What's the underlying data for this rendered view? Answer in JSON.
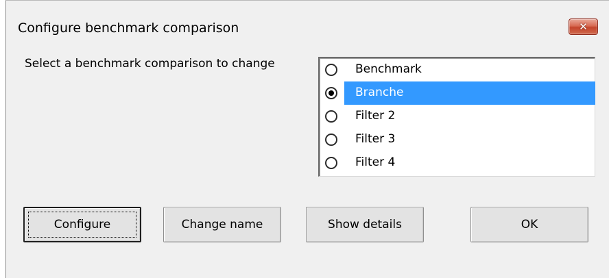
{
  "window": {
    "title": "Configure benchmark comparison",
    "close_label": "✕"
  },
  "prompt": "Select a benchmark comparison to change",
  "options": [
    {
      "label": "Benchmark",
      "selected": false
    },
    {
      "label": "Branche",
      "selected": true
    },
    {
      "label": "Filter 2",
      "selected": false
    },
    {
      "label": "Filter 3",
      "selected": false
    },
    {
      "label": "Filter 4",
      "selected": false
    }
  ],
  "buttons": {
    "configure": "Configure",
    "change_name": "Change name",
    "show_details": "Show details",
    "ok": "OK"
  },
  "colors": {
    "selection": "#3399ff",
    "close_button": "#c4452c",
    "dialog_background": "#f0f0f0"
  }
}
